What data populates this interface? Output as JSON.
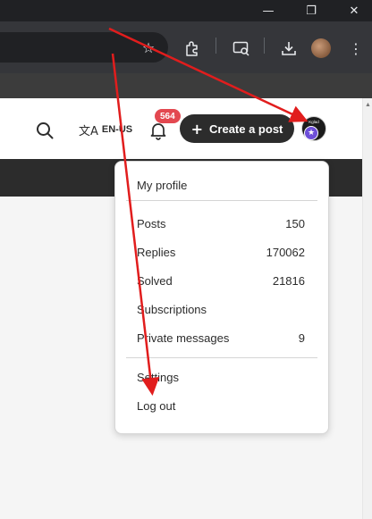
{
  "browser": {
    "window_controls": [
      "minimize",
      "restore",
      "close"
    ],
    "toolbar_icons": [
      "star-icon",
      "extensions-icon",
      "reading-mode-icon",
      "download-icon",
      "profile-avatar"
    ]
  },
  "header": {
    "language": "EN-US",
    "notification_count": "564",
    "create_post_label": "Create a post",
    "avatar_text": "Kglad"
  },
  "menu": {
    "items": [
      {
        "label": "My profile",
        "value": ""
      },
      {
        "label": "Posts",
        "value": "150"
      },
      {
        "label": "Replies",
        "value": "170062"
      },
      {
        "label": "Solved",
        "value": "21816"
      },
      {
        "label": "Subscriptions",
        "value": ""
      },
      {
        "label": "Private messages",
        "value": "9"
      },
      {
        "label": "Settings",
        "value": ""
      },
      {
        "label": "Log out",
        "value": ""
      }
    ]
  },
  "colors": {
    "annotation_arrow": "#e11d1d",
    "dark_button": "#2c2c2c",
    "notification_badge": "#e34850",
    "rank_badge": "#6e4fd9",
    "browser_toolbar": "#35363a"
  }
}
